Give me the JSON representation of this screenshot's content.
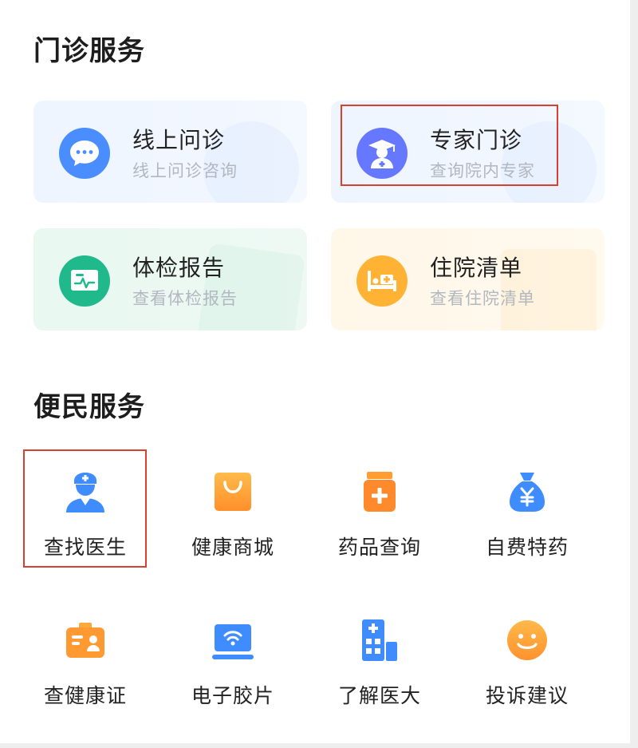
{
  "outpatient": {
    "title": "门诊服务",
    "cards": [
      {
        "title": "线上问诊",
        "subtitle": "线上问诊咨询",
        "icon": "chat-bubble-icon"
      },
      {
        "title": "专家门诊",
        "subtitle": "查询院内专家",
        "icon": "doctor-graduate-icon"
      },
      {
        "title": "体检报告",
        "subtitle": "查看体检报告",
        "icon": "ecg-report-icon"
      },
      {
        "title": "住院清单",
        "subtitle": "查看住院清单",
        "icon": "hospital-bed-icon"
      }
    ]
  },
  "convenience": {
    "title": "便民服务",
    "items": [
      {
        "label": "查找医生",
        "icon": "doctor-icon"
      },
      {
        "label": "健康商城",
        "icon": "shopping-bag-icon"
      },
      {
        "label": "药品查询",
        "icon": "medicine-bottle-icon"
      },
      {
        "label": "自费特药",
        "icon": "money-bag-icon"
      },
      {
        "label": "查健康证",
        "icon": "id-card-icon"
      },
      {
        "label": "电子胶片",
        "icon": "film-scanner-icon"
      },
      {
        "label": "了解医大",
        "icon": "hospital-building-icon"
      },
      {
        "label": "投诉建议",
        "icon": "smiley-icon"
      }
    ]
  },
  "colors": {
    "accent_blue": "#3f8cff",
    "accent_green": "#1fb98b",
    "accent_orange": "#ffb234",
    "highlight_red": "#d8412f"
  }
}
